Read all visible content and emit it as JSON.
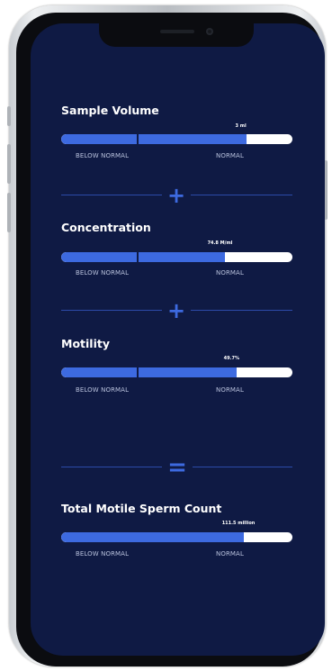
{
  "sections": [
    {
      "title": "Sample Volume",
      "value_label": "3 ml",
      "fill_fraction": 0.8,
      "below_label": "BELOW NORMAL",
      "normal_label": "NORMAL"
    },
    {
      "title": "Concentration",
      "value_label": "74.8 M/ml",
      "fill_fraction": 0.71,
      "below_label": "BELOW NORMAL",
      "normal_label": "NORMAL"
    },
    {
      "title": "Motility",
      "value_label": "49.7%",
      "fill_fraction": 0.76,
      "below_label": "BELOW NORMAL",
      "normal_label": "NORMAL"
    },
    {
      "title": "Total Motile Sperm Count",
      "value_label": "111.5 million",
      "fill_fraction": 0.79,
      "below_label": "BELOW NORMAL",
      "normal_label": "NORMAL"
    }
  ],
  "operators": {
    "plus": "+",
    "equals": "="
  },
  "colors": {
    "screen_background": "#0f1a44",
    "bar_fill": "#3d6ae0",
    "bar_track": "#ffffff",
    "accent": "#3d6ae0"
  }
}
